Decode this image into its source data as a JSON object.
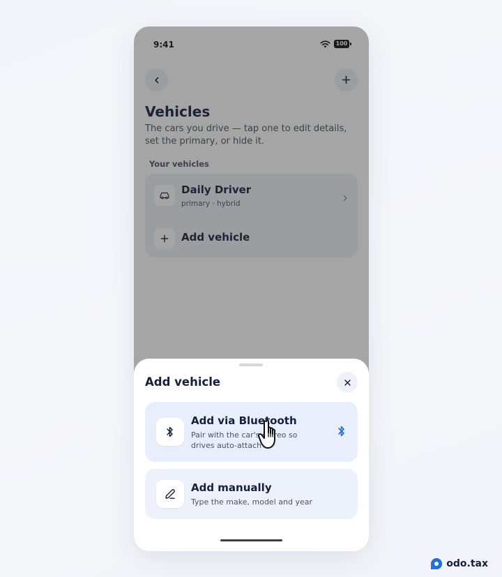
{
  "status_bar": {
    "time": "9:41",
    "battery": "100"
  },
  "page": {
    "title": "Vehicles",
    "subtitle": "The cars you drive — tap one to edit details, set the primary, or hide it.",
    "section_label": "Your vehicles"
  },
  "vehicles": [
    {
      "name": "Daily Driver",
      "meta": "primary · hybrid",
      "icon": "car-icon"
    }
  ],
  "add_vehicle_row": {
    "label": "Add vehicle",
    "icon": "plus-icon"
  },
  "sheet": {
    "title": "Add vehicle",
    "options": [
      {
        "title": "Add via Bluetooth",
        "description": "Pair with the car's stereo so drives auto-attach",
        "icon": "bluetooth-icon",
        "trailing_icon": "bluetooth-icon"
      },
      {
        "title": "Add manually",
        "description": "Type the make, model and year",
        "icon": "pencil-icon"
      }
    ]
  },
  "brand": {
    "name": "odo.tax"
  },
  "colors": {
    "accent": "#1e6fe0",
    "text_primary": "#14213d",
    "text_secondary": "#4a5268",
    "card_bg": "#eef1f8",
    "highlight_bg": "#e9eefc"
  }
}
